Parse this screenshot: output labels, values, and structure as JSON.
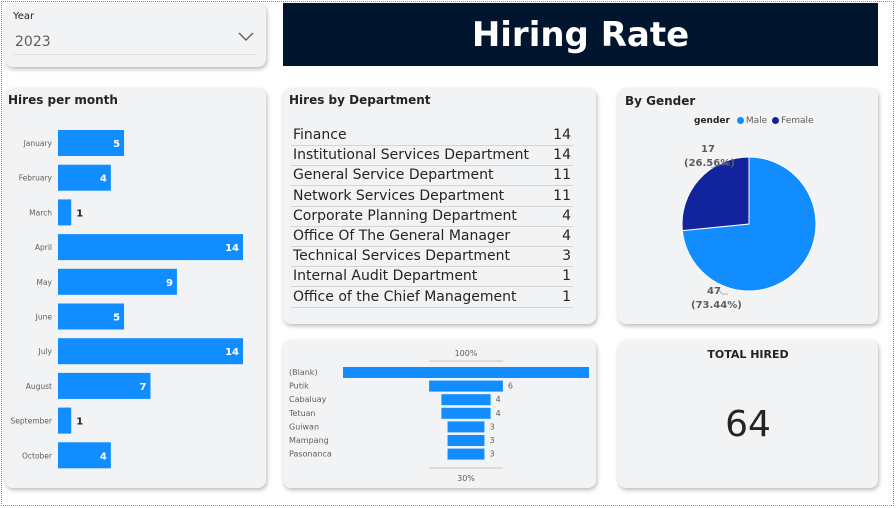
{
  "year_slicer": {
    "label": "Year",
    "value": "2023"
  },
  "banner": {
    "title": "Hiring Rate"
  },
  "colors": {
    "accent": "#118dff",
    "dark_navy": "#02152e",
    "female": "#12239e"
  },
  "total_hired": {
    "label": "TOTAL HIRED",
    "value": "64"
  },
  "chart_data": [
    {
      "type": "bar",
      "orientation": "horizontal",
      "title": "Hires per month",
      "categories": [
        "January",
        "February",
        "March",
        "April",
        "May",
        "June",
        "July",
        "August",
        "September",
        "October"
      ],
      "values": [
        5,
        4,
        1,
        14,
        9,
        5,
        14,
        7,
        1,
        4
      ],
      "value_labels": [
        "5",
        "4",
        "1",
        "14",
        "9",
        "5",
        "14",
        "7",
        "1",
        "4"
      ],
      "xlim": [
        0,
        14
      ]
    },
    {
      "type": "table",
      "title": "Hires by Department",
      "rows": [
        {
          "name": "Finance",
          "value": "14"
        },
        {
          "name": "Institutional Services Department",
          "value": "14"
        },
        {
          "name": "General Service Department",
          "value": "11"
        },
        {
          "name": "Network Services Department",
          "value": "11"
        },
        {
          "name": "Corporate Planning Department",
          "value": "4"
        },
        {
          "name": "Office Of The General Manager",
          "value": "4"
        },
        {
          "name": "Technical Services Department",
          "value": "3"
        },
        {
          "name": "Internal Audit Department",
          "value": "1"
        },
        {
          "name": "Office of the Chief Management",
          "value": "1"
        }
      ]
    },
    {
      "type": "pie",
      "title": "By Gender",
      "legend_title": "gender",
      "legend_position": "top",
      "slices": [
        {
          "name": "Male",
          "value": 47,
          "label_value": "47",
          "label_pct": "(73.44%)",
          "color": "#118dff"
        },
        {
          "name": "Female",
          "value": 17,
          "label_value": "17",
          "label_pct": "(26.56%)",
          "color": "#12239e"
        }
      ]
    },
    {
      "type": "bar",
      "subtype": "funnel",
      "categories": [
        "(Blank)",
        "Putik",
        "Cabaluay",
        "Tetuan",
        "Guiwan",
        "Mampang",
        "Pasonanca"
      ],
      "values": [
        20,
        6,
        4,
        4,
        3,
        3,
        3
      ],
      "value_labels": [
        "",
        "6",
        "4",
        "4",
        "3",
        "3",
        "3"
      ],
      "top_label": "100%",
      "bottom_label": "30%"
    }
  ]
}
